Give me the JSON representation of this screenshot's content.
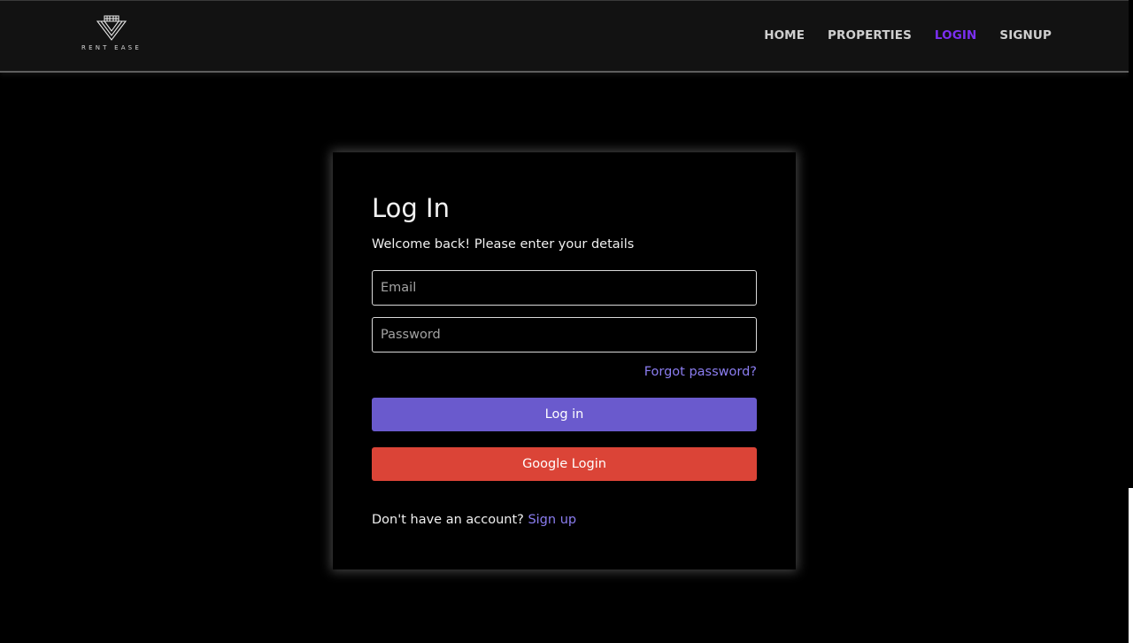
{
  "brand": {
    "logo_icon": "building-logo-icon",
    "name": "RENT EASE"
  },
  "nav": {
    "items": [
      {
        "label": "HOME",
        "active": false
      },
      {
        "label": "PROPERTIES",
        "active": false
      },
      {
        "label": "LOGIN",
        "active": true
      },
      {
        "label": "SIGNUP",
        "active": false
      }
    ],
    "active_color": "#7b2ff2"
  },
  "login_card": {
    "title": "Log In",
    "subtitle": "Welcome back! Please enter your details",
    "email": {
      "placeholder": "Email",
      "value": ""
    },
    "password": {
      "placeholder": "Password",
      "value": ""
    },
    "forgot_label": "Forgot password?",
    "login_button_label": "Log in",
    "google_button_label": "Google Login",
    "signup_prompt": "Don't have an account?",
    "signup_link_label": "Sign up"
  },
  "colors": {
    "background": "#000000",
    "header": "#121212",
    "primary_button": "#6a5acd",
    "google_button": "#db4437",
    "link": "#8b7df0"
  }
}
